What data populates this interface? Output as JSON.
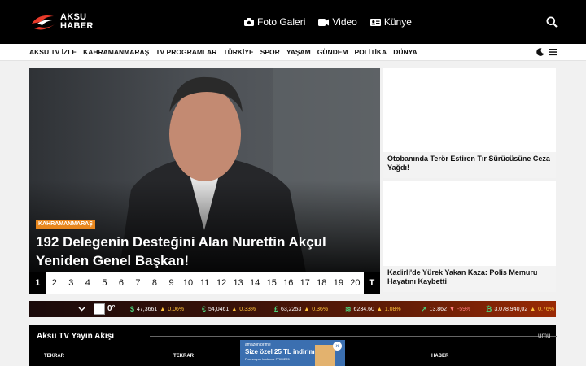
{
  "header": {
    "logo_line1": "AKSU",
    "logo_line2": "HABER",
    "nav": [
      {
        "label": "Foto Galeri",
        "icon": "camera-icon"
      },
      {
        "label": "Video",
        "icon": "video-icon"
      },
      {
        "label": "Künye",
        "icon": "id-card-icon"
      }
    ],
    "search_icon": "search-icon"
  },
  "categories": [
    "AKSU TV İZLE",
    "KAHRAMANMARAŞ",
    "TV PROGRAMLAR",
    "TÜRKİYE",
    "SPOR",
    "YAŞAM",
    "GÜNDEM",
    "POLİTİKA",
    "DÜNYA"
  ],
  "hero": {
    "category": "KAHRAMANMARAŞ",
    "title": "192 Delegenin Desteğini Alan Nurettin Akçul Yeniden Genel Başkan!",
    "pages": [
      "1",
      "2",
      "3",
      "4",
      "5",
      "6",
      "7",
      "8",
      "9",
      "10",
      "11",
      "12",
      "13",
      "14",
      "15",
      "16",
      "17",
      "18",
      "19",
      "20",
      "T"
    ]
  },
  "side_news": [
    {
      "title": "Otobanında Terör Estiren Tır Sürücüsüne Ceza Yağdı!"
    },
    {
      "title": "Kadirli'de Yürek Yakan Kaza: Polis Memuru Hayatını Kaybetti"
    }
  ],
  "ticker": {
    "temperature": "0°",
    "items": [
      {
        "symbol": "$",
        "value": "47,3661",
        "change": "0.06%",
        "dir": "up"
      },
      {
        "symbol": "€",
        "value": "54,0461",
        "change": "0.33%",
        "dir": "up"
      },
      {
        "symbol": "£",
        "value": "63,2253",
        "change": "0.36%",
        "dir": "up"
      },
      {
        "symbol": "≋",
        "value": "6234.60",
        "change": "1.08%",
        "dir": "up"
      },
      {
        "symbol": "↗",
        "value": "13.862",
        "change": "-59%",
        "dir": "down"
      },
      {
        "symbol": "₿",
        "value": "3.078.940,02",
        "change": "0.76%",
        "dir": "up"
      }
    ]
  },
  "flow": {
    "title": "Aksu TV Yayın Akışı",
    "all_label": "Tümü",
    "columns": [
      "TEKRAR",
      "TEKRAR",
      "HABER"
    ]
  },
  "ad": {
    "brand": "amazon prime",
    "headline": "Size özel 25 TL indirim",
    "sub": "Promosyon kodunuz PRIME25"
  },
  "colors": {
    "accent": "#e8871e",
    "topbar": "#000000"
  }
}
